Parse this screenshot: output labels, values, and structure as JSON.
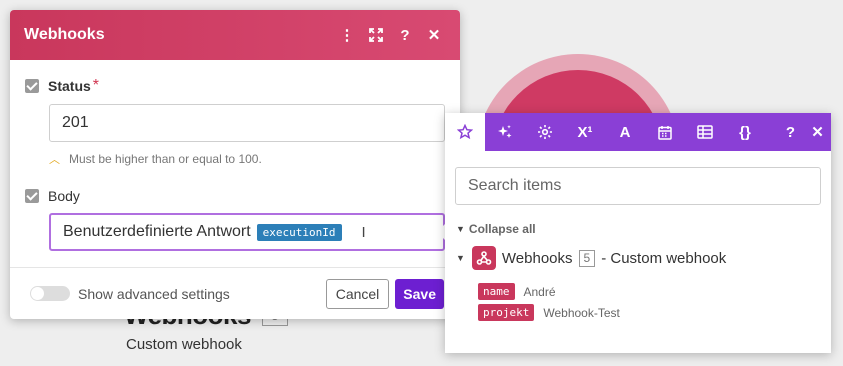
{
  "background": {
    "module_title": "Webhooks",
    "module_count": "5",
    "module_subtitle": "Custom webhook"
  },
  "dialog": {
    "title": "Webhooks",
    "header_icons": [
      "more-vertical-icon",
      "expand-icon",
      "help-icon",
      "close-icon"
    ],
    "status": {
      "label": "Status",
      "required_mark": "*",
      "value": "201",
      "hint": "Must be higher than or equal to 100."
    },
    "body": {
      "label": "Body",
      "text": "Benutzerdefinierte Antwort",
      "token": "executionId"
    },
    "footer": {
      "advanced_label": "Show advanced settings",
      "cancel_label": "Cancel",
      "save_label": "Save"
    }
  },
  "panel": {
    "toolbar_icons": [
      "star-icon",
      "sparkle-icon",
      "gear-icon",
      "superscript-icon",
      "text-icon",
      "calendar-icon",
      "table-icon",
      "braces-icon"
    ],
    "toolbar_superscript": "X¹",
    "search_placeholder": "Search items",
    "collapse_label": "Collapse all",
    "module": {
      "name": "Webhooks",
      "count": "5",
      "suffix": "- Custom webhook"
    },
    "items": [
      {
        "key": "name",
        "value": "André"
      },
      {
        "key": "projekt",
        "value": "Webhook-Test"
      }
    ]
  },
  "colors": {
    "webhook_red": "#c9375c",
    "panel_purple": "#8a3fd6",
    "save_purple": "#6d1fd1",
    "token_blue": "#2c7fb8"
  }
}
